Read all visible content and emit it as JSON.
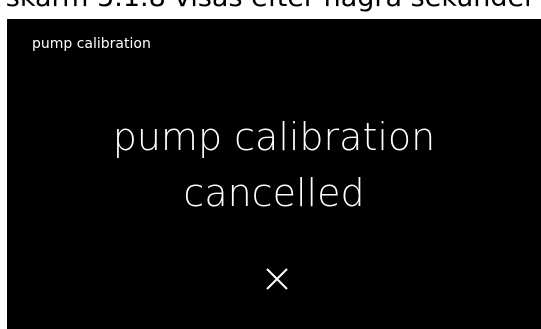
{
  "document": {
    "caption": "skärm 5.1.8 visas efter några sekunder"
  },
  "screen": {
    "title": "pump calibration",
    "message_line1": "pump calibration",
    "message_line2": "cancelled",
    "close_icon": "close-icon"
  },
  "colors": {
    "screen_background": "#000000",
    "text": "#ffffff"
  }
}
